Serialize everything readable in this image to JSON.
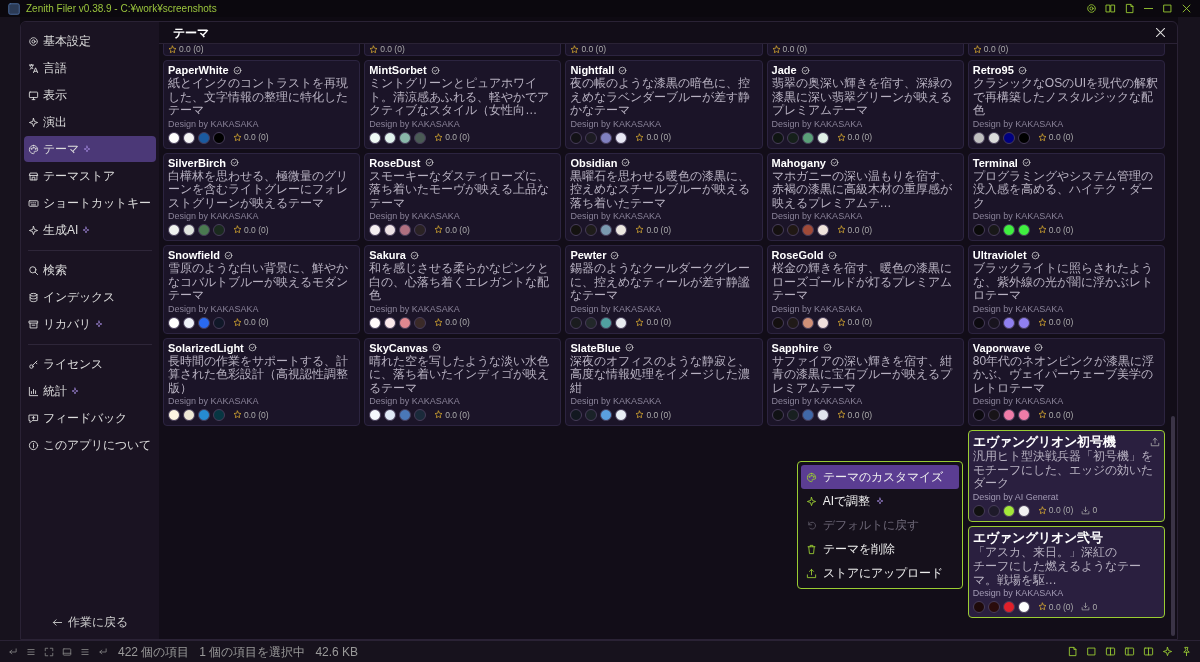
{
  "title_bar": {
    "title": "Zenith Filer v0.38.9 - C:¥work¥screenshots"
  },
  "settings_dialog": {
    "sidebar": {
      "sections": [
        {
          "items": [
            {
              "label": "基本設定",
              "selected": false,
              "sparkle": false
            },
            {
              "label": "言語",
              "selected": false,
              "sparkle": false
            },
            {
              "label": "表示",
              "selected": false,
              "sparkle": false
            },
            {
              "label": "演出",
              "selected": false,
              "sparkle": false
            },
            {
              "label": "テーマ",
              "selected": true,
              "sparkle": true
            },
            {
              "label": "テーマストア",
              "selected": false,
              "sparkle": false
            },
            {
              "label": "ショートカットキー",
              "selected": false,
              "sparkle": false
            },
            {
              "label": "生成AI",
              "selected": false,
              "sparkle": true
            }
          ]
        },
        {
          "items": [
            {
              "label": "検索",
              "selected": false,
              "sparkle": false
            },
            {
              "label": "インデックス",
              "selected": false,
              "sparkle": false
            },
            {
              "label": "リカバリ",
              "selected": false,
              "sparkle": true
            }
          ]
        },
        {
          "items": [
            {
              "label": "ライセンス",
              "selected": false,
              "sparkle": false
            },
            {
              "label": "統計",
              "selected": false,
              "sparkle": true
            },
            {
              "label": "フィードバック",
              "selected": false,
              "sparkle": false
            },
            {
              "label": "このアプリについて",
              "selected": false,
              "sparkle": false
            }
          ]
        }
      ],
      "back_link": "作業に戻る"
    },
    "header": {
      "title": "テーマ"
    },
    "partial_row": [
      {
        "rating": "0.0 (0)"
      },
      {
        "rating": "0.0 (0)"
      },
      {
        "rating": "0.0 (0)"
      },
      {
        "rating": "0.0 (0)"
      },
      {
        "rating": "0.0 (0)"
      }
    ],
    "themes": [
      {
        "kind": "preset",
        "name": "PaperWhite",
        "description": "紙とインクのコントラストを再現した、文字情報の整理に特化したテーマ",
        "author": "Design by KAKASAKA",
        "swatches": [
          {
            "color": "#ffffff"
          },
          {
            "color": "#f4f4f4"
          },
          {
            "color": "#1a5aa0"
          },
          {
            "color": "#000000"
          }
        ],
        "rating": "0.0 (0)"
      },
      {
        "kind": "preset",
        "name": "MintSorbet",
        "description": "ミントグリーンとピュアホワイト。清涼感あふれる、軽やかでアクティブなスタイル（女性向…",
        "author": "Design by KAKASAKA",
        "swatches": [
          {
            "color": "#f0faf6"
          },
          {
            "color": "#e0f2ec"
          },
          {
            "color": "#8ab8aa"
          },
          {
            "color": "#4a5a55"
          }
        ],
        "rating": "0.0 (0)"
      },
      {
        "kind": "preset",
        "name": "Nightfall",
        "description": "夜の帳のような漆黒の暗色に、控えめなラベンダーブルーが差す静かなテーマ",
        "author": "Design by KAKASAKA",
        "swatches": [
          {
            "color": "#131217"
          },
          {
            "color": "#1c1b22"
          },
          {
            "color": "#8080c0"
          },
          {
            "color": "#e8e8f4"
          }
        ],
        "rating": "0.0 (0)"
      },
      {
        "kind": "preset",
        "name": "Jade",
        "description": "翡翠の奥深い輝きを宿す、深緑の漆黒に深い翡翠グリーンが映えるプレミアムテーマ",
        "author": "Design by KAKASAKA",
        "swatches": [
          {
            "color": "#0f1512"
          },
          {
            "color": "#15201a"
          },
          {
            "color": "#5aa078"
          },
          {
            "color": "#e0f0e6"
          }
        ],
        "rating": "0.0 (0)"
      },
      {
        "kind": "preset",
        "name": "Retro95",
        "description": "クラシックなOSのUIを現代の解釈で再構築したノスタルジックな配色",
        "author": "Design by KAKASAKA",
        "swatches": [
          {
            "color": "#c0c0c0"
          },
          {
            "color": "#dcdcdc"
          },
          {
            "color": "#000080"
          },
          {
            "color": "#000000"
          }
        ],
        "rating": "0.0 (0)"
      },
      {
        "kind": "preset",
        "name": "SilverBirch",
        "description": "白樺林を思わせる、極微量のグリーンを含むライトグレーにフォレストグリーンが映えるテーマ",
        "author": "Design by KAKASAKA",
        "swatches": [
          {
            "color": "#f0f2ef"
          },
          {
            "color": "#e0e4de"
          },
          {
            "color": "#4a7a50"
          },
          {
            "color": "#1a2a1e"
          }
        ],
        "rating": "0.0 (0)"
      },
      {
        "kind": "preset",
        "name": "RoseDust",
        "description": "スモーキーなダスティローズに、落ち着いたモーヴが映える上品なテーマ",
        "author": "Design by KAKASAKA",
        "swatches": [
          {
            "color": "#f4eef0"
          },
          {
            "color": "#ece2e4"
          },
          {
            "color": "#b07080"
          },
          {
            "color": "#2a2224"
          }
        ],
        "rating": "0.0 (0)"
      },
      {
        "kind": "preset",
        "name": "Obsidian",
        "description": "黒曜石を思わせる暖色の漆黒に、控えめなスチールブルーが映える落ち着いたテーマ",
        "author": "Design by KAKASAKA",
        "swatches": [
          {
            "color": "#141210"
          },
          {
            "color": "#1e1c1a"
          },
          {
            "color": "#7a9ab0"
          },
          {
            "color": "#ece8e0"
          }
        ],
        "rating": "0.0 (0)"
      },
      {
        "kind": "preset",
        "name": "Mahogany",
        "description": "マホガニーの深い温もりを宿す、赤褐の漆黒に高級木材の重厚感が映えるプレミアムテ…",
        "author": "Design by KAKASAKA",
        "swatches": [
          {
            "color": "#141010"
          },
          {
            "color": "#201814"
          },
          {
            "color": "#a04a38"
          },
          {
            "color": "#f0e4dc"
          }
        ],
        "rating": "0.0 (0)"
      },
      {
        "kind": "preset",
        "name": "Terminal",
        "description": "プログラミングやシステム管理の没入感を高める、ハイテク・ダーク",
        "author": "Design by KAKASAKA",
        "swatches": [
          {
            "color": "#0a0a0a"
          },
          {
            "color": "#181818"
          },
          {
            "color": "#40f040"
          },
          {
            "color": "#40f040"
          }
        ],
        "rating": "0.0 (0)"
      },
      {
        "kind": "preset",
        "name": "Snowfield",
        "description": "雪原のような白い背景に、鮮やかなコバルトブルーが映えるモダンテーマ",
        "author": "Design by KAKASAKA",
        "swatches": [
          {
            "color": "#ffffff"
          },
          {
            "color": "#eef2f8"
          },
          {
            "color": "#2a6af0"
          },
          {
            "color": "#101828"
          }
        ],
        "rating": "0.0 (0)"
      },
      {
        "kind": "preset",
        "name": "Sakura",
        "description": "和を感じさせる柔らかなピンクと白の、心落ち着くエレガントな配色",
        "author": "Design by KAKASAKA",
        "swatches": [
          {
            "color": "#fffafa"
          },
          {
            "color": "#fae8ea"
          },
          {
            "color": "#e08890"
          },
          {
            "color": "#3a2a28"
          }
        ],
        "rating": "0.0 (0)"
      },
      {
        "kind": "preset",
        "name": "Pewter",
        "description": "錫器のようなクールダークグレーに、控えめなティールが差す静謐なテーマ",
        "author": "Design by KAKASAKA",
        "swatches": [
          {
            "color": "#1a1c1e"
          },
          {
            "color": "#22282a"
          },
          {
            "color": "#50a0a0"
          },
          {
            "color": "#e8ecf0"
          }
        ],
        "rating": "0.0 (0)"
      },
      {
        "kind": "preset",
        "name": "RoseGold",
        "description": "桜金の輝きを宿す、暖色の漆黒にローズゴールドが灯るプレミアムテーマ",
        "author": "Design by KAKASAKA",
        "swatches": [
          {
            "color": "#141010"
          },
          {
            "color": "#201a18"
          },
          {
            "color": "#d09078"
          },
          {
            "color": "#f0e0dc"
          }
        ],
        "rating": "0.0 (0)"
      },
      {
        "kind": "preset",
        "name": "Ultraviolet",
        "description": "ブラックライトに照らされたような、紫外線の光が闇に浮かぶレトロテーマ",
        "author": "Design by KAKASAKA",
        "swatches": [
          {
            "color": "#0c0a10"
          },
          {
            "color": "#18141e"
          },
          {
            "color": "#9080f0"
          },
          {
            "color": "#9080f0"
          }
        ],
        "rating": "0.0 (0)"
      },
      {
        "kind": "preset",
        "name": "SolarizedLight",
        "description": "長時間の作業をサポートする、計算された色彩設計（高視認性調整版）",
        "author": "Design by KAKASAKA",
        "swatches": [
          {
            "color": "#fdf6e3"
          },
          {
            "color": "#eee8d5"
          },
          {
            "color": "#268bd2"
          },
          {
            "color": "#073642"
          }
        ],
        "rating": "0.0 (0)"
      },
      {
        "kind": "preset",
        "name": "SkyCanvas",
        "description": "晴れた空を写したような淡い水色に、落ち着いたインディゴが映えるテーマ",
        "author": "Design by KAKASAKA",
        "swatches": [
          {
            "color": "#f4f8fc"
          },
          {
            "color": "#e0eaf6"
          },
          {
            "color": "#4a78b8"
          },
          {
            "color": "#1a2a3a"
          }
        ],
        "rating": "0.0 (0)"
      },
      {
        "kind": "preset",
        "name": "SlateBlue",
        "description": "深夜のオフィスのような静寂と、高度な情報処理をイメージした濃紺",
        "author": "Design by KAKASAKA",
        "swatches": [
          {
            "color": "#121820"
          },
          {
            "color": "#1a2228"
          },
          {
            "color": "#5aa0e0"
          },
          {
            "color": "#e8eef4"
          }
        ],
        "rating": "0.0 (0)"
      },
      {
        "kind": "preset",
        "name": "Sapphire",
        "description": "サファイアの深い輝きを宿す、紺青の漆黒に宝石ブルーが映えるプレミアムテーマ",
        "author": "Design by KAKASAKA",
        "swatches": [
          {
            "color": "#101214"
          },
          {
            "color": "#182020"
          },
          {
            "color": "#4068a8"
          },
          {
            "color": "#e0e4ec"
          }
        ],
        "rating": "0.0 (0)"
      },
      {
        "kind": "preset",
        "name": "Vaporwave",
        "description": "80年代のネオンピンクが漆黒に浮かぶ、ヴェイパーウェーブ美学のレトロテーマ",
        "author": "Design by KAKASAKA",
        "swatches": [
          {
            "color": "#0c0a10"
          },
          {
            "color": "#181418"
          },
          {
            "color": "#f07ca8"
          },
          {
            "color": "#f07ca8"
          }
        ],
        "rating": "0.0 (0)"
      },
      {
        "kind": "custom",
        "name": "エヴァングリオン初号機",
        "upload": true,
        "description_lines": [
          "汎用ヒト型決戦兵器「初号機」をモチーフにした、エッジの効いたダーク"
        ],
        "author": "Design by AI Generat",
        "swatches": [
          {
            "color": "#111111"
          },
          {
            "color": "#1e1a2a"
          },
          {
            "color": "#a4e83a"
          },
          {
            "color": "#f2f2f2"
          }
        ],
        "rating": "0.0 (0)",
        "downloads": "0"
      },
      {
        "kind": "custom",
        "name": "エヴァングリオン弐号",
        "upload": false,
        "description_lines": [
          "「アスカ、来日。」深紅の",
          "チーフにした燃えるようなテーマ。戦場を駆…"
        ],
        "author": "Design by KAKASAKA",
        "swatches": [
          {
            "color": "#1e0a0a"
          },
          {
            "color": "#2a0c0c"
          },
          {
            "color": "#e0202a"
          },
          {
            "color": "#ffffff"
          }
        ],
        "rating": "0.0 (0)",
        "downloads": "0"
      }
    ],
    "context_menu": {
      "items": [
        {
          "label": "テーマのカスタマイズ",
          "selected": true,
          "disabled": false,
          "sparkle": false
        },
        {
          "label": "AIで調整",
          "selected": false,
          "disabled": false,
          "sparkle": true
        },
        {
          "label": "デフォルトに戻す",
          "selected": false,
          "disabled": true,
          "sparkle": false
        },
        {
          "label": "テーマを削除",
          "selected": false,
          "disabled": false,
          "sparkle": false
        },
        {
          "label": "ストアにアップロード",
          "selected": false,
          "disabled": false,
          "sparkle": false
        }
      ]
    }
  },
  "status_bar": {
    "item_count": "422 個の項目",
    "selection": "1 個の項目を選択中",
    "size": "42.6 KB"
  }
}
